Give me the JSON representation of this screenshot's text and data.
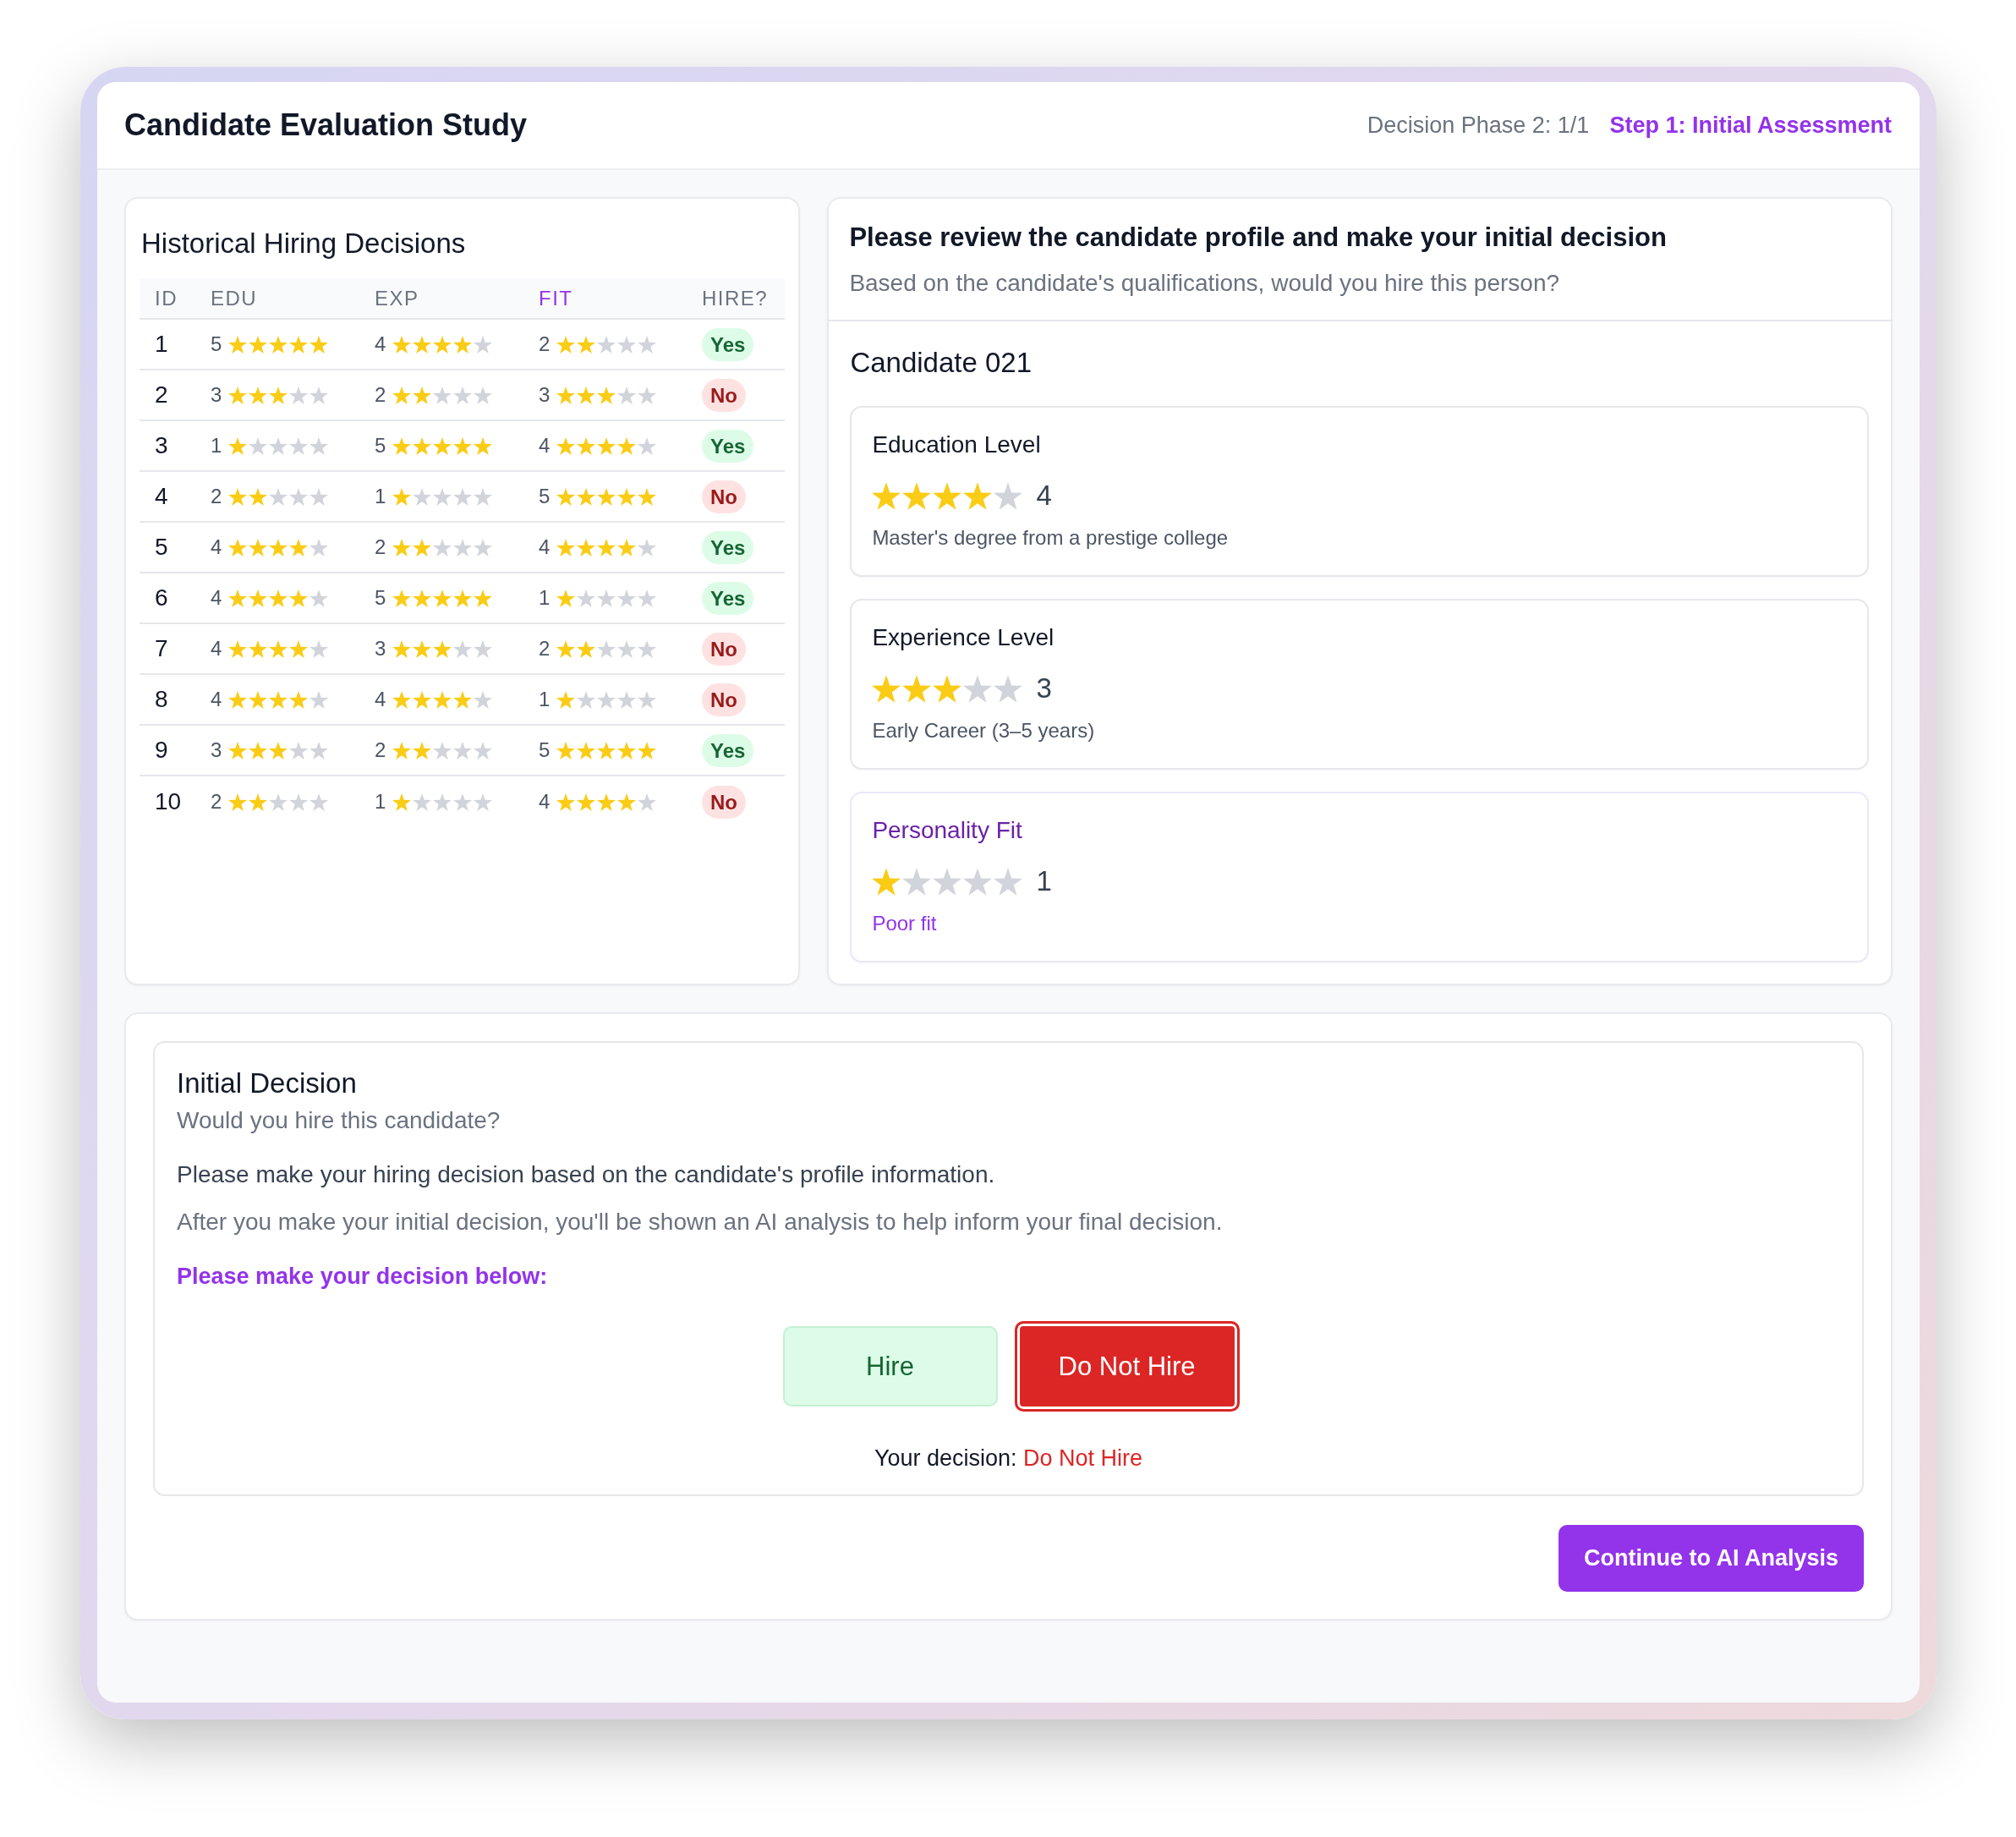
{
  "header": {
    "title": "Candidate Evaluation Study",
    "phase": "Decision Phase 2: 1/1",
    "step": "Step 1: Initial Assessment"
  },
  "history": {
    "title": "Historical Hiring Decisions",
    "columns": [
      {
        "label": "ID",
        "highlighted": false
      },
      {
        "label": "EDU",
        "highlighted": false
      },
      {
        "label": "EXP",
        "highlighted": false
      },
      {
        "label": "FIT",
        "highlighted": true
      },
      {
        "label": "HIRE?",
        "highlighted": false
      }
    ],
    "rows": [
      {
        "id": "1",
        "ratings": [
          {
            "score": "5",
            "stars": 5
          },
          {
            "score": "4",
            "stars": 4
          },
          {
            "score": "2",
            "stars": 2
          }
        ],
        "outcome": {
          "label": "Yes",
          "hired": true
        }
      },
      {
        "id": "2",
        "ratings": [
          {
            "score": "3",
            "stars": 3
          },
          {
            "score": "2",
            "stars": 2
          },
          {
            "score": "3",
            "stars": 3
          }
        ],
        "outcome": {
          "label": "No",
          "hired": false
        }
      },
      {
        "id": "3",
        "ratings": [
          {
            "score": "1",
            "stars": 1
          },
          {
            "score": "5",
            "stars": 5
          },
          {
            "score": "4",
            "stars": 4
          }
        ],
        "outcome": {
          "label": "Yes",
          "hired": true
        }
      },
      {
        "id": "4",
        "ratings": [
          {
            "score": "2",
            "stars": 2
          },
          {
            "score": "1",
            "stars": 1
          },
          {
            "score": "5",
            "stars": 5
          }
        ],
        "outcome": {
          "label": "No",
          "hired": false
        }
      },
      {
        "id": "5",
        "ratings": [
          {
            "score": "4",
            "stars": 4
          },
          {
            "score": "2",
            "stars": 2
          },
          {
            "score": "4",
            "stars": 4
          }
        ],
        "outcome": {
          "label": "Yes",
          "hired": true
        }
      },
      {
        "id": "6",
        "ratings": [
          {
            "score": "4",
            "stars": 4
          },
          {
            "score": "5",
            "stars": 5
          },
          {
            "score": "1",
            "stars": 1
          }
        ],
        "outcome": {
          "label": "Yes",
          "hired": true
        }
      },
      {
        "id": "7",
        "ratings": [
          {
            "score": "4",
            "stars": 4
          },
          {
            "score": "3",
            "stars": 3
          },
          {
            "score": "2",
            "stars": 2
          }
        ],
        "outcome": {
          "label": "No",
          "hired": false
        }
      },
      {
        "id": "8",
        "ratings": [
          {
            "score": "4",
            "stars": 4
          },
          {
            "score": "4",
            "stars": 4
          },
          {
            "score": "1",
            "stars": 1
          }
        ],
        "outcome": {
          "label": "No",
          "hired": false
        }
      },
      {
        "id": "9",
        "ratings": [
          {
            "score": "3",
            "stars": 3
          },
          {
            "score": "2",
            "stars": 2
          },
          {
            "score": "5",
            "stars": 5
          }
        ],
        "outcome": {
          "label": "Yes",
          "hired": true
        }
      },
      {
        "id": "10",
        "ratings": [
          {
            "score": "2",
            "stars": 2
          },
          {
            "score": "1",
            "stars": 1
          },
          {
            "score": "4",
            "stars": 4
          }
        ],
        "outcome": {
          "label": "No",
          "hired": false
        }
      }
    ]
  },
  "profile": {
    "title": "Please review the candidate profile and make your initial decision",
    "subtitle": "Based on the candidate's qualifications, would you hire this person?",
    "candidate": "Candidate 021",
    "attributes": [
      {
        "label": "Education Level",
        "stars": 4,
        "score": "4",
        "description": "Master's degree from a prestige college",
        "highlighted": false
      },
      {
        "label": "Experience Level",
        "stars": 3,
        "score": "3",
        "description": "Early Career (3–5 years)",
        "highlighted": false
      },
      {
        "label": "Personality Fit",
        "stars": 1,
        "score": "1",
        "description": "Poor fit",
        "highlighted": true
      }
    ]
  },
  "decision": {
    "title": "Initial Decision",
    "question": "Would you hire this candidate?",
    "instruction": "Please make your hiring decision based on the candidate's profile information.",
    "note": "After you make your initial decision, you'll be shown an AI analysis to help inform your final decision.",
    "prompt": "Please make your decision below:",
    "options": [
      {
        "label": "Hire",
        "kind": "hire",
        "selected": false
      },
      {
        "label": "Do Not Hire",
        "kind": "reject",
        "selected": true
      }
    ],
    "result_label": "Your decision:",
    "result_value": "Do Not Hire"
  },
  "continue_button": {
    "label": "Continue to AI Analysis"
  }
}
